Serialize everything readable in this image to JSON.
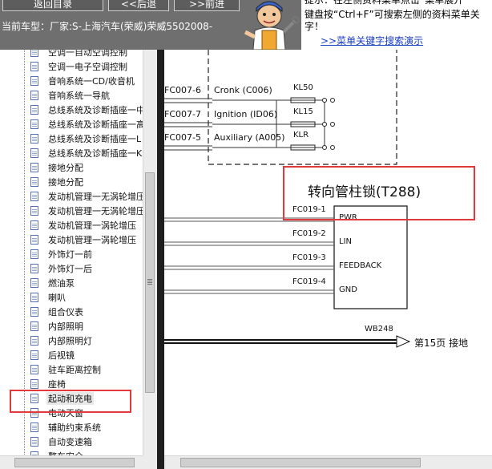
{
  "header": {
    "back_to_catalog": "返回目录",
    "back": "<<后退",
    "forward": ">>前进",
    "current_car": "当前车型：厂家:S-上海汽车(荣威)荣威5502008-"
  },
  "hint": {
    "line1": "提示：在左侧资料菜单点击“菜单展开",
    "line2": "键盘按“Ctrl+F”可搜索左侧的资料菜单关",
    "line3": "字！",
    "link": ">>菜单关键字搜索演示"
  },
  "tree": {
    "items": [
      {
        "label": "空调一自动空调控制"
      },
      {
        "label": "空调一电子空调控制"
      },
      {
        "label": "音响系统一CD/收音机"
      },
      {
        "label": "音响系统一导航"
      },
      {
        "label": "总线系统及诊断插座一中"
      },
      {
        "label": "总线系统及诊断插座一高"
      },
      {
        "label": "总线系统及诊断插座一L"
      },
      {
        "label": "总线系统及诊断插座一K"
      },
      {
        "label": "接地分配"
      },
      {
        "label": "接地分配"
      },
      {
        "label": "发动机管理一无涡轮增压"
      },
      {
        "label": "发动机管理一无涡轮增压"
      },
      {
        "label": "发动机管理一涡轮增压"
      },
      {
        "label": "发动机管理一涡轮增压"
      },
      {
        "label": "外饰灯一前"
      },
      {
        "label": "外饰灯一后"
      },
      {
        "label": "燃油泵"
      },
      {
        "label": "喇叭"
      },
      {
        "label": "组合仪表"
      },
      {
        "label": "内部照明"
      },
      {
        "label": "内部照明灯"
      },
      {
        "label": "后视镜"
      },
      {
        "label": "驻车距离控制"
      },
      {
        "label": "座椅"
      },
      {
        "label": "起动和充电",
        "selected": true
      },
      {
        "label": "电动天窗"
      },
      {
        "label": "辅助约束系统"
      },
      {
        "label": "自动变速箱"
      },
      {
        "label": "整车安全"
      }
    ]
  },
  "diagram": {
    "top_rows": [
      {
        "pin": "FC007-6",
        "signal": "Cronk (C006)",
        "relay": "KL50"
      },
      {
        "pin": "FC007-7",
        "signal": "Ignition (ID06)",
        "relay": "KL15"
      },
      {
        "pin": "FC007-5",
        "signal": "Auxiliary (A005)",
        "relay": "KLR"
      }
    ],
    "component_title": "转向管柱锁(T288)",
    "lock_pins": [
      {
        "pin": "FC019-1",
        "name": "PWR"
      },
      {
        "pin": "FC019-2",
        "name": "LIN"
      },
      {
        "pin": "FC019-3",
        "name": "FEEDBACK"
      },
      {
        "pin": "FC019-4",
        "name": "GND"
      }
    ],
    "ground_wire": "WB248",
    "ground_ref": "第15页  接地"
  },
  "colors": {
    "highlight": "#e23a3a",
    "header_bg": "#6f6f6f",
    "link": "#1a3fc0"
  }
}
